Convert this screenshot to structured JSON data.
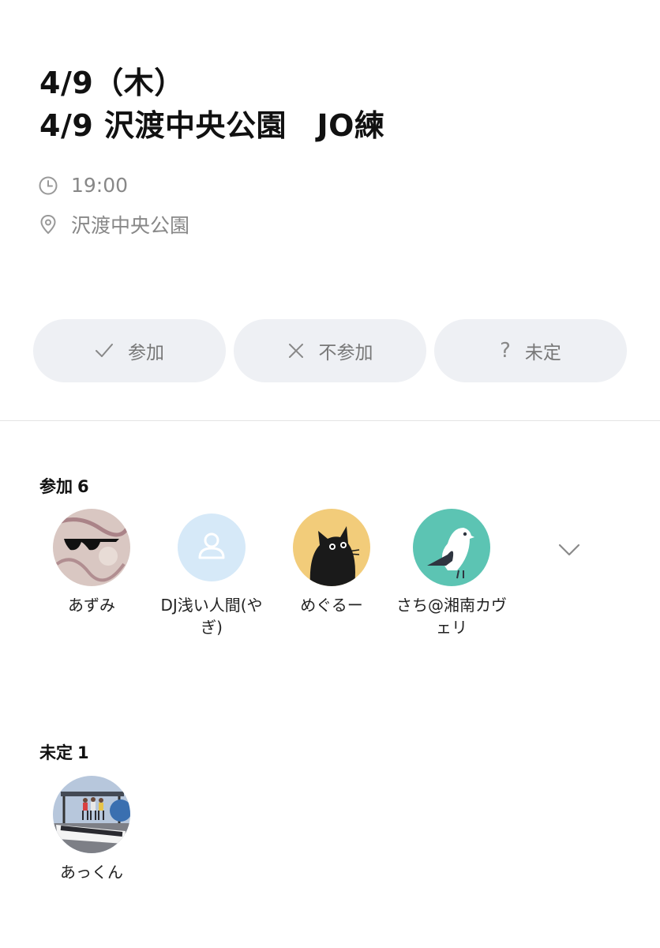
{
  "event": {
    "date_line": "4/9（木）",
    "title": "4/9 沢渡中央公園　JO練",
    "time": "19:00",
    "place": "沢渡中央公園"
  },
  "rsvp_buttons": {
    "join": {
      "label": "参加",
      "icon": "check-icon"
    },
    "decline": {
      "label": "不参加",
      "icon": "x-icon"
    },
    "undecided": {
      "label": "未定",
      "icon": "question-icon",
      "glyph": "?"
    }
  },
  "join_section": {
    "label": "参加",
    "count": "6",
    "members": [
      {
        "name": "あずみ",
        "avatar": "sunglasses-photo"
      },
      {
        "name": "DJ浅い人間(やぎ)",
        "avatar": "default-person-icon"
      },
      {
        "name": "めぐるー",
        "avatar": "black-cat-icon"
      },
      {
        "name": "さち@湘南カヴェリ",
        "avatar": "bird-icon"
      }
    ]
  },
  "undecided_section": {
    "label": "未定",
    "count": "1",
    "members": [
      {
        "name": "あっくん",
        "avatar": "gotemba-photo"
      }
    ]
  },
  "colors": {
    "button_bg": "#eef0f4",
    "muted_text": "#888888",
    "avatar_blue": "#d6e9f8",
    "avatar_yellow": "#f2cc7a",
    "avatar_teal": "#5cc4b3"
  }
}
